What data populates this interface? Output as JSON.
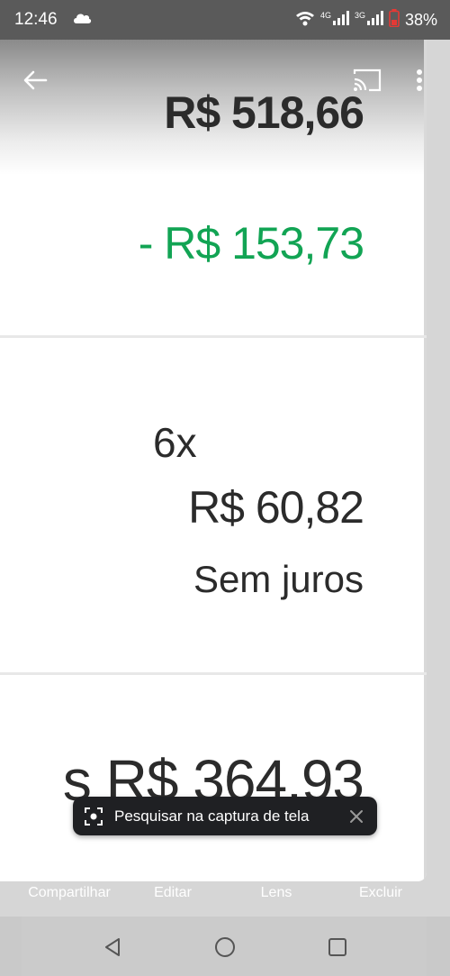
{
  "status_bar": {
    "time": "12:46",
    "network_1": "4G",
    "network_2": "3G",
    "battery": "38%",
    "icons": [
      "cloud-icon",
      "wifi-icon",
      "signal-icon",
      "signal-icon",
      "battery-low-icon"
    ],
    "colors": {
      "battery_alert": "#e53935"
    }
  },
  "toolbar": {
    "icons": [
      "back-arrow-icon",
      "cast-icon",
      "more-vert-icon"
    ]
  },
  "screenshot_content": {
    "total_price": "R$ 518,66",
    "discount": "- R$ 153,73",
    "installments": {
      "count": "6x",
      "price": "R$ 60,82",
      "note": "Sem juros"
    },
    "bottom_price": "s R$ 364,93",
    "colors": {
      "discount": "#12a454"
    }
  },
  "toast": {
    "text": "Pesquisar na captura de tela",
    "icons": [
      "lens-icon",
      "close-icon"
    ]
  },
  "actions": [
    {
      "label": "Compartilhar",
      "icon": "share-icon"
    },
    {
      "label": "Editar",
      "icon": "sliders-icon"
    },
    {
      "label": "Lens",
      "icon": "lens-icon"
    },
    {
      "label": "Excluir",
      "icon": "trash-icon"
    }
  ],
  "nav": {
    "icons": [
      "back-triangle-icon",
      "home-circle-icon",
      "recents-square-icon"
    ]
  }
}
